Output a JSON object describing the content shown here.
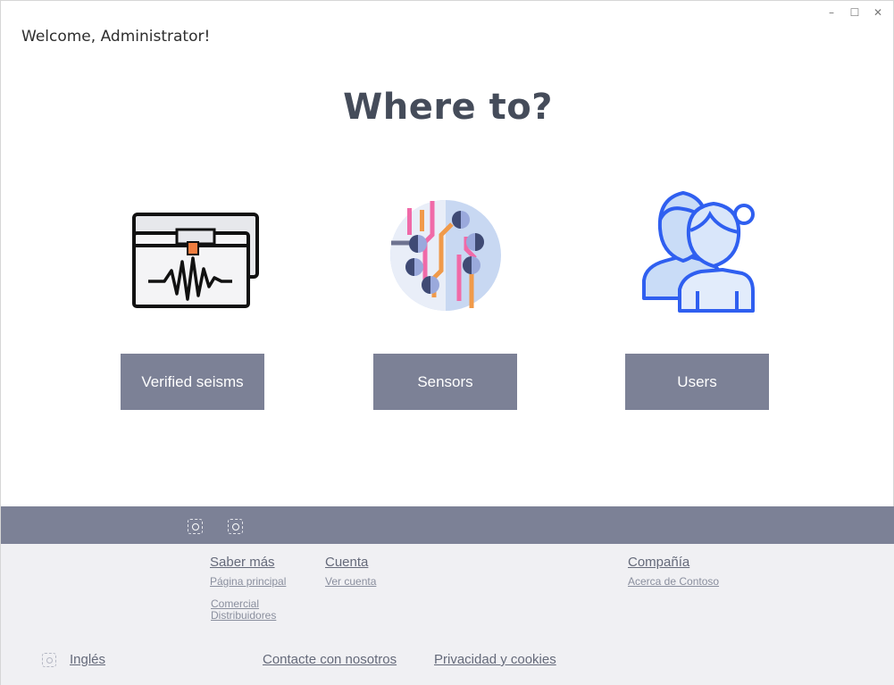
{
  "window": {
    "controls": {
      "minimize": "–",
      "maximize": "☐",
      "close": "✕"
    }
  },
  "header": {
    "welcome": "Welcome, Administrator!"
  },
  "main": {
    "title": "Where to?",
    "options": [
      {
        "label": "Verified seisms",
        "icon": "seismograph-icon"
      },
      {
        "label": "Sensors",
        "icon": "sensor-circuit-icon"
      },
      {
        "label": "Users",
        "icon": "users-icon"
      }
    ]
  },
  "footer": {
    "social_icons": [
      "social-icon-1",
      "social-icon-2"
    ],
    "columns": [
      {
        "heading": "Saber más",
        "links": [
          "Página principal",
          "Comercial",
          "Distribuidores"
        ]
      },
      {
        "heading": "Cuenta",
        "links": [
          "Ver cuenta"
        ]
      },
      {
        "heading": "Compañía",
        "links": [
          "Acerca de Contoso"
        ]
      }
    ],
    "language": "Inglés",
    "contact": "Contacte con nosotros",
    "privacy": "Privacidad y cookies"
  },
  "colors": {
    "button_bg": "#7c8196",
    "heading": "#454c5a",
    "footer_bg": "#f0f0f3",
    "icon_blue": "#2f5ff0"
  }
}
